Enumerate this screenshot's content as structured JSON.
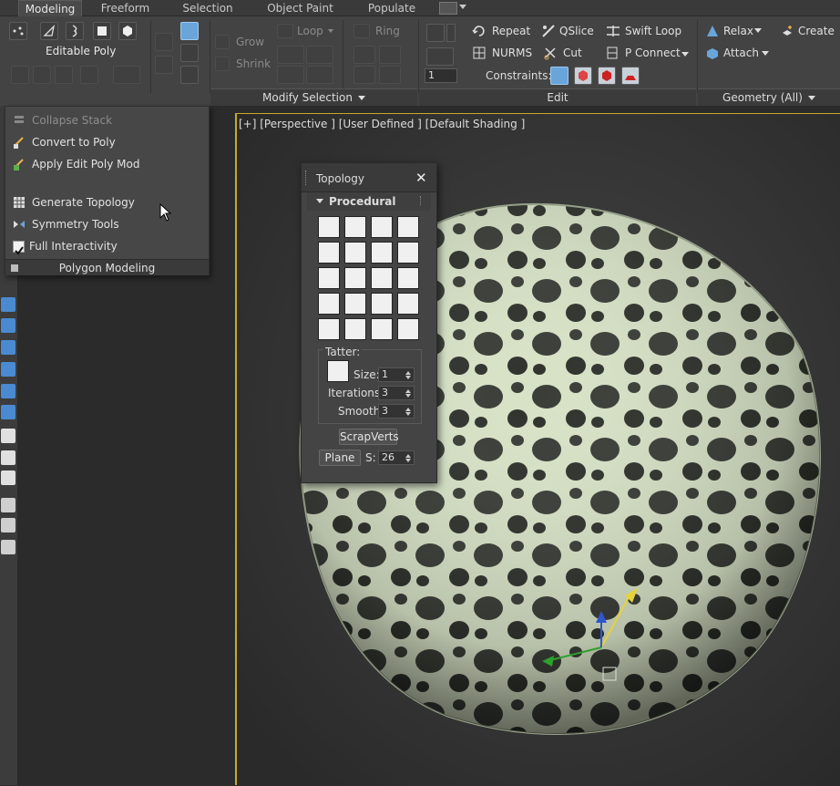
{
  "tabs": [
    {
      "label": "Modeling",
      "active": true
    },
    {
      "label": "Freeform"
    },
    {
      "label": "Selection"
    },
    {
      "label": "Object Paint"
    },
    {
      "label": "Populate"
    }
  ],
  "ribbon": {
    "object_type": "Editable Poly",
    "grow_label": "Grow",
    "shrink_label": "Shrink",
    "loop_label": "Loop",
    "ring_label": "Ring",
    "modify_selection_label": "Modify Selection",
    "repeat_label": "Repeat",
    "qslice_label": "QSlice",
    "swift_loop_label": "Swift Loop",
    "nurms_label": "NURMS",
    "cut_label": "Cut",
    "pconnect_label": "P Connect",
    "constraints_label": "Constraints:",
    "edit_label": "Edit",
    "relax_label": "Relax",
    "create_label": "Create",
    "attach_label": "Attach",
    "geometry_label": "Geometry (All)",
    "spinner_value": "1"
  },
  "menu": {
    "items": [
      {
        "label": "Collapse Stack",
        "enabled": false
      },
      {
        "label": "Convert to Poly",
        "enabled": true
      },
      {
        "label": "Apply Edit Poly Mod",
        "enabled": true
      },
      {
        "label": "Generate Topology",
        "enabled": true
      },
      {
        "label": "Symmetry Tools",
        "enabled": true
      },
      {
        "label": "Full Interactivity",
        "enabled": true,
        "checked": true
      }
    ],
    "footer": "Polygon Modeling"
  },
  "viewport": {
    "label": "[+] [Perspective ] [User Defined ] [Default Shading ]"
  },
  "topology": {
    "title": "Topology",
    "section": "Procedural",
    "tatter_label": "Tatter:",
    "size_label": "Size:",
    "size_value": "1",
    "iterations_label": "Iterations:",
    "iterations_value": "3",
    "smooth_label": "Smooth:",
    "smooth_value": "3",
    "scrapverts_label": "ScrapVerts",
    "plane_label": "Plane",
    "s_label": "S:",
    "s_value": "26"
  },
  "colors": {
    "accent_blue": "#6aa5d9",
    "viewport_border": "#c8a92a",
    "mesh": "#d7e2c6"
  }
}
